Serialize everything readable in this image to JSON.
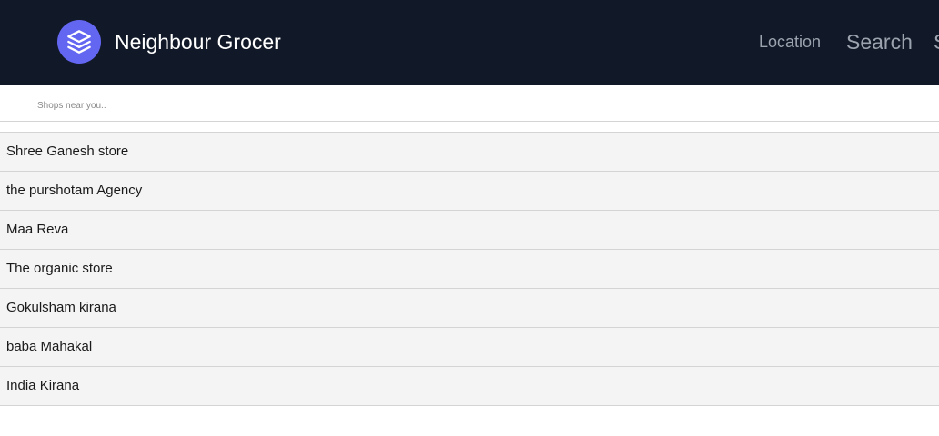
{
  "navbar": {
    "brand": "Neighbour Grocer",
    "logo_icon": "layers-icon",
    "links": [
      "Location",
      "Search",
      "S"
    ],
    "colors": {
      "background": "#111827",
      "logo": "#6366f1",
      "link": "#9ca3af"
    }
  },
  "subheader": {
    "text": "Shops near you.."
  },
  "shops": [
    "Shree Ganesh store",
    "the purshotam Agency",
    "Maa Reva",
    "The organic store",
    "Gokulsham kirana",
    "baba Mahakal",
    "India Kirana"
  ]
}
